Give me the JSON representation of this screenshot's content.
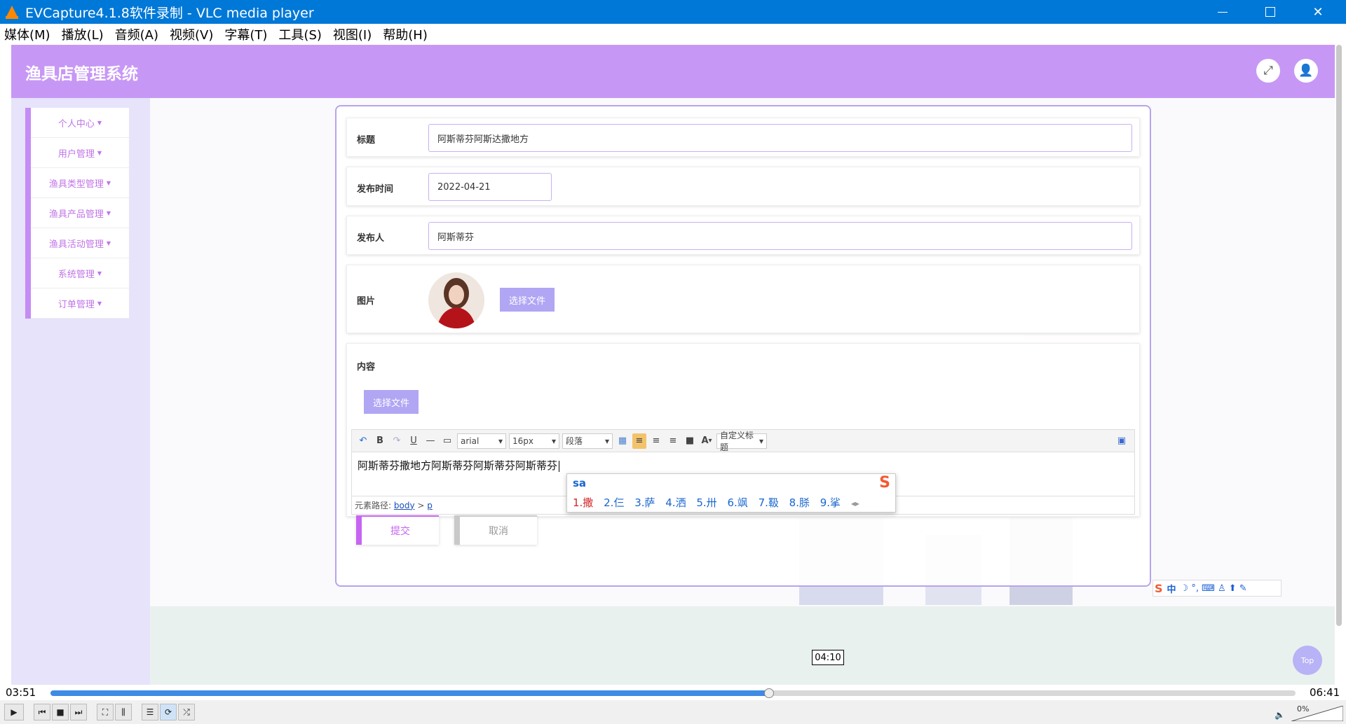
{
  "window": {
    "title": "EVCapture4.1.8软件录制 - VLC media player",
    "min_glyph": "",
    "restore_glyph": "❐",
    "close_glyph": "✕"
  },
  "menu": [
    "媒体(M)",
    "播放(L)",
    "音频(A)",
    "视频(V)",
    "字幕(T)",
    "工具(S)",
    "视图(I)",
    "帮助(H)"
  ],
  "app": {
    "logo": "渔具店管理系统",
    "header_icons": [
      "fullscreen-icon",
      "user-icon"
    ],
    "header_glyphs": {
      "fullscreen": "⤢",
      "user": "👤"
    },
    "accent": "#c797f5"
  },
  "sidebar": {
    "items": [
      {
        "label": "个人中心"
      },
      {
        "label": "用户管理"
      },
      {
        "label": "渔具类型管理"
      },
      {
        "label": "渔具产品管理"
      },
      {
        "label": "渔具活动管理"
      },
      {
        "label": "系统管理"
      },
      {
        "label": "订单管理"
      }
    ],
    "caret": "▼"
  },
  "form": {
    "title_label": "标题",
    "title_value": "阿斯蒂芬阿斯达撒地方",
    "date_label": "发布时间",
    "date_value": "2022-04-21",
    "author_label": "发布人",
    "author_value": "阿斯蒂芬",
    "image_label": "图片",
    "image_button": "选择文件",
    "content_label": "内容",
    "content_button": "选择文件",
    "submit": "提交",
    "cancel": "取消"
  },
  "editor": {
    "font": "arial",
    "size": "16px",
    "paragraph": "段落",
    "custom_title": "自定义标题",
    "text": "阿斯蒂芬撒地方阿斯蒂芬阿斯蒂芬阿斯蒂芬",
    "path_label": "元素路径:",
    "path_body": "body",
    "path_sep": ">",
    "path_p": "p",
    "tool_glyphs": {
      "undo": "↶",
      "bold": "B",
      "redo": "↷",
      "underline": "U",
      "hr": "—",
      "document": "▭",
      "table": "▦",
      "align_left": "≡",
      "align_center": "≡",
      "align_right": "≡",
      "justify": "■",
      "font_color": "A",
      "source": "▣",
      "dropdown": "▾"
    }
  },
  "ime": {
    "pinyin": "sa",
    "candidates": [
      "1.撒",
      "2.仨",
      "3.萨",
      "4.洒",
      "5.卅",
      "6.飒",
      "7.靸",
      "8.脎",
      "9.挲"
    ],
    "logo": "S",
    "page_arrows": "◂▸",
    "status": {
      "logo": "S",
      "mode": "中",
      "icons": "☽ °, ⌨ ♙ ⬆ ✎"
    }
  },
  "top_button": "Top",
  "player": {
    "elapsed": "03:51",
    "total": "06:41",
    "hover_time": "04:10",
    "progress": 0.577,
    "volume": "0%",
    "volume_icon": "🔈",
    "button_glyphs": {
      "play": "▶",
      "prev": "⏮",
      "stop": "■",
      "next": "⏭",
      "fullscreen": "⛶",
      "extended": "⫼",
      "playlist": "☰",
      "loop": "⟳",
      "random": "⤮"
    }
  }
}
